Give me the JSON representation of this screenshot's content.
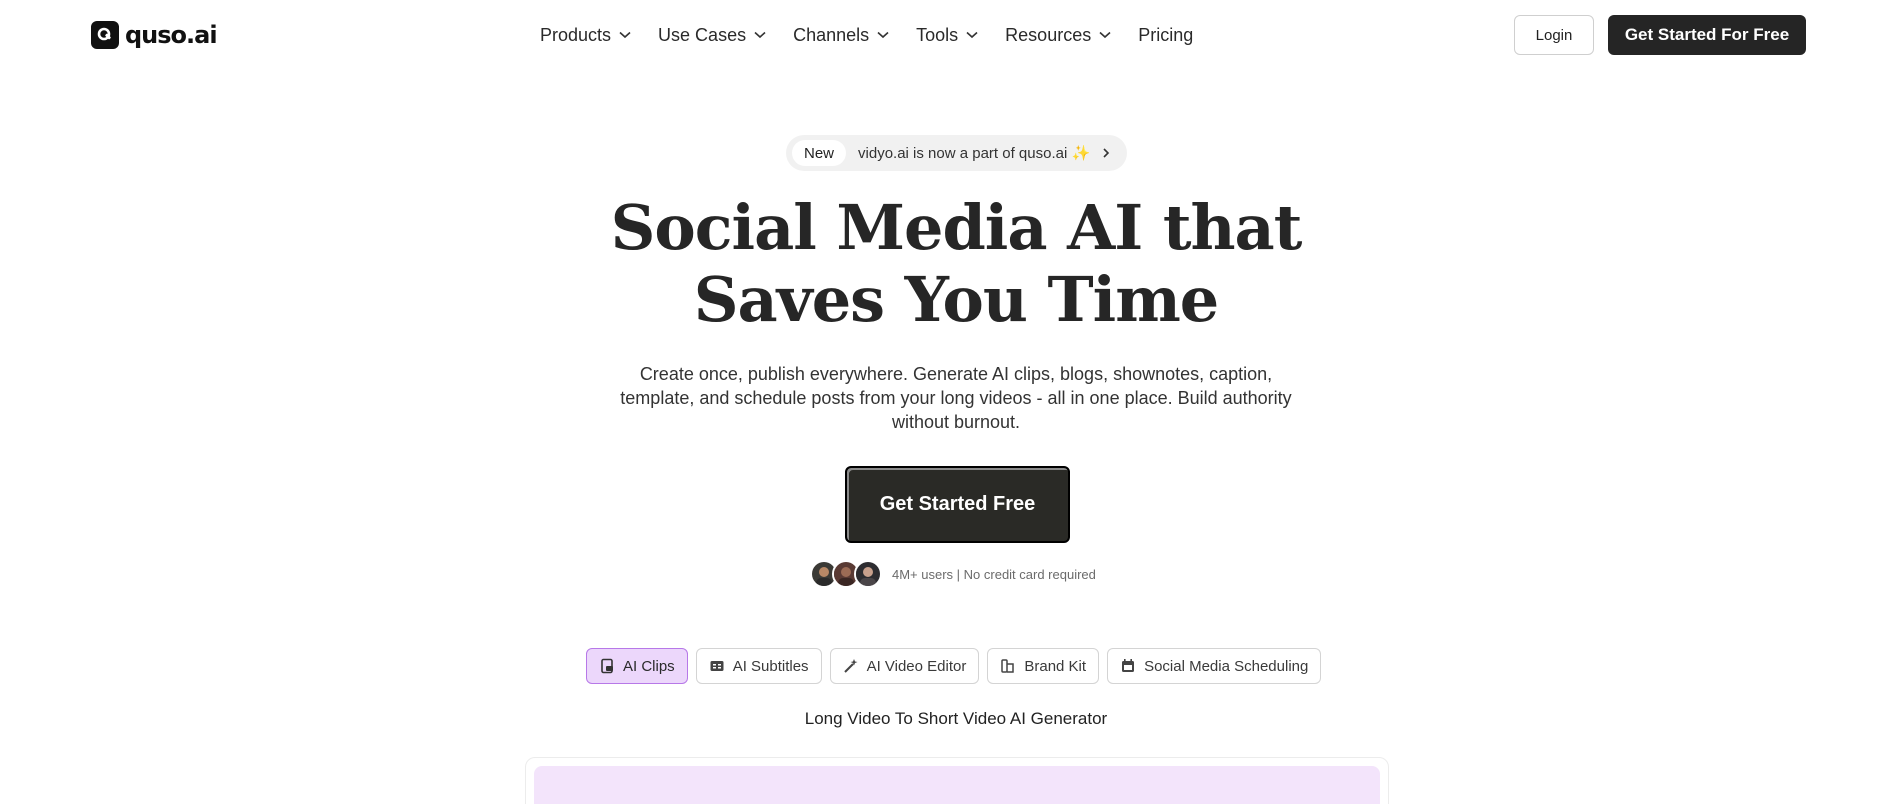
{
  "brand": {
    "logo_text": "quso.ai",
    "logo_icon": "q-logo-icon"
  },
  "nav": {
    "items": [
      {
        "label": "Products",
        "has_dropdown": true
      },
      {
        "label": "Use Cases",
        "has_dropdown": true
      },
      {
        "label": "Channels",
        "has_dropdown": true
      },
      {
        "label": "Tools",
        "has_dropdown": true
      },
      {
        "label": "Resources",
        "has_dropdown": true
      },
      {
        "label": "Pricing",
        "has_dropdown": false
      }
    ],
    "login_label": "Login",
    "cta_label": "Get Started For Free"
  },
  "announcement": {
    "badge": "New",
    "text": "vidyo.ai is now a part of quso.ai ✨"
  },
  "hero": {
    "title_line1": "Social Media AI that",
    "title_line2": "Saves You Time",
    "subtitle": "Create once, publish everywhere. Generate AI clips, blogs, shownotes, caption, template, and schedule posts from your long videos - all in one place. Build authority without burnout.",
    "cta_label": "Get Started Free",
    "social_proof": "4M+ users | No credit card required"
  },
  "tabs": [
    {
      "label": "AI Clips",
      "icon": "clips-icon",
      "active": true
    },
    {
      "label": "AI Subtitles",
      "icon": "subtitles-icon",
      "active": false
    },
    {
      "label": "AI Video Editor",
      "icon": "magic-wand-icon",
      "active": false
    },
    {
      "label": "Brand Kit",
      "icon": "brand-kit-icon",
      "active": false
    },
    {
      "label": "Social Media Scheduling",
      "icon": "calendar-icon",
      "active": false
    }
  ],
  "section": {
    "title": "Long Video To Short Video AI Generator"
  },
  "colors": {
    "primary_dark": "#252525",
    "active_tab_bg": "#ecd7fb",
    "active_tab_border": "#b778e8",
    "preview_bg": "#f3e4fb"
  }
}
